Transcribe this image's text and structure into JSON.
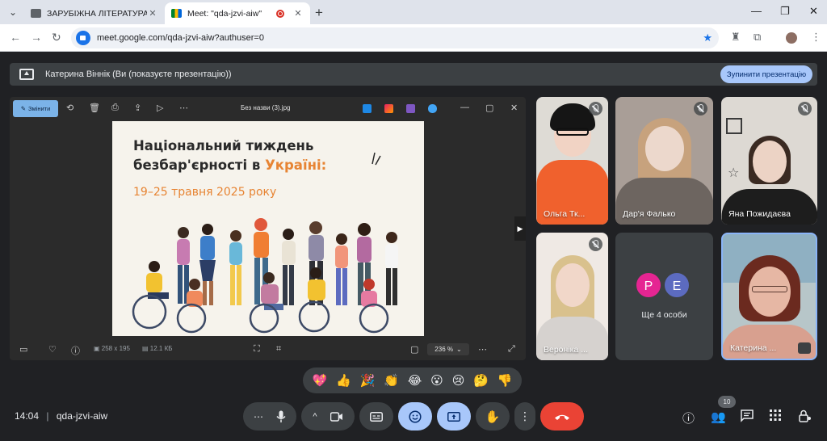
{
  "browser": {
    "tabs": [
      {
        "title": "ЗАРУБІЖНА ЛІТЕРАТУРА Вінн",
        "active": false
      },
      {
        "title": "Meet: \"qda-jzvi-aiw\"",
        "active": true,
        "recording": true
      }
    ],
    "url": "meet.google.com/qda-jzvi-aiw?authuser=0"
  },
  "banner": {
    "text": "Катерина Віннік (Ви (показуєте презентацію))",
    "stop_button": "Зупинити презентацію"
  },
  "viewer": {
    "edit_label": "Змінити",
    "file_name": "Без назви (3).jpg",
    "dimensions": "258 x 195",
    "file_size": "12.1 КБ",
    "zoom": "236 %",
    "image": {
      "line1": "Національний тиждень",
      "line2_prefix": "безбар'єрності в ",
      "line2_highlight": "Україні:",
      "dates": "19–25 травня 2025 року"
    }
  },
  "participants": [
    {
      "name": "Ольга Тк...",
      "muted": true
    },
    {
      "name": "Дар'я Фалько",
      "muted": true
    },
    {
      "name": "Яна Пожидаєва",
      "muted": true
    },
    {
      "name": "Вероніка ...",
      "muted": true
    },
    {
      "name": "Катерина ...",
      "muted": false,
      "presenting": true
    }
  ],
  "more_tile": {
    "avatars": [
      "P",
      "E"
    ],
    "label": "Ще 4 особи",
    "avatar_colors": [
      "#e52592",
      "#5c6bc0"
    ]
  },
  "reactions": [
    "💖",
    "👍",
    "🎉",
    "👏",
    "😂",
    "😮",
    "😢",
    "🤔",
    "👎"
  ],
  "bottom": {
    "time": "14:04",
    "separator": "|",
    "meeting_code": "qda-jzvi-aiw",
    "people_count": "10"
  },
  "colors": {
    "meet_bg": "#202124",
    "control_bg": "#3c4043",
    "accent_blue": "#a8c7fa",
    "leave_red": "#ea4335",
    "image_orange": "#e78433"
  }
}
